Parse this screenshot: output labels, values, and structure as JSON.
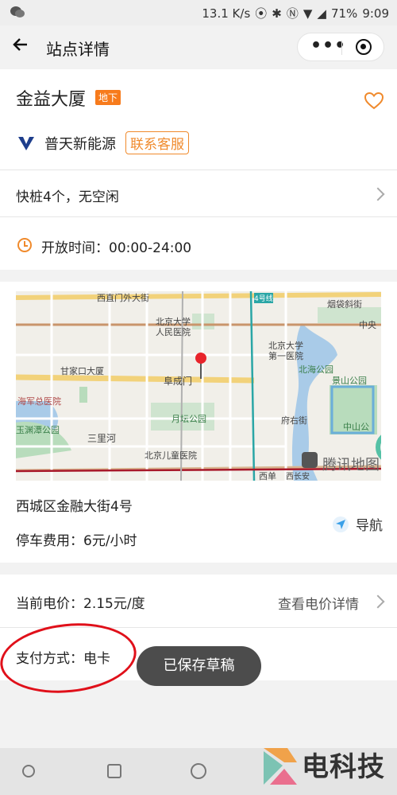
{
  "status_bar": {
    "speed": "13.1 K/s",
    "battery": "71%",
    "time": "9:09"
  },
  "nav": {
    "title": "站点详情"
  },
  "station": {
    "name": "金益大厦",
    "tag": "地下",
    "operator": "普天新能源",
    "contact_label": "联系客服"
  },
  "chargers": {
    "summary": "快桩4个，无空闲"
  },
  "hours": {
    "label": "开放时间：00:00-24:00"
  },
  "map": {
    "labels": {
      "xizhimen": "西直门外大街",
      "pku_people": "北京大学",
      "pku_people2": "人民医院",
      "ganjiakou": "甘家口大厦",
      "fuchengmen": "阜成门",
      "yuetan": "月坛公园",
      "sanlihe": "三里河",
      "children": "北京儿童医院",
      "pku_first": "北京大学",
      "pku_first2": "第一医院",
      "beihai": "北海公园",
      "jingshan": "景山公园",
      "haijun": "海军总医院",
      "yuyuantan": "玉渊潭公园",
      "yandai": "烟袋斜街",
      "zhongyang": "中央",
      "fuyou": "府右街",
      "zhongshan": "中山公",
      "xidan": "西单",
      "xichang": "西长安",
      "line4": "4号线",
      "tencent": "腾讯地图"
    }
  },
  "location": {
    "address": "西城区金融大街4号",
    "parking_fee": "停车费用：6元/小时",
    "navigate_label": "导航"
  },
  "price": {
    "current": "当前电价：2.15元/度",
    "details_link": "查看电价详情"
  },
  "payment": {
    "label": "支付方式：电卡"
  },
  "toast": {
    "message": "已保存草稿"
  },
  "watermark": {
    "text": "电科技"
  },
  "colors": {
    "accent_orange": "#f77b1c",
    "nav_blue": "#3aa0e8",
    "annotation_red": "#e0101a"
  }
}
